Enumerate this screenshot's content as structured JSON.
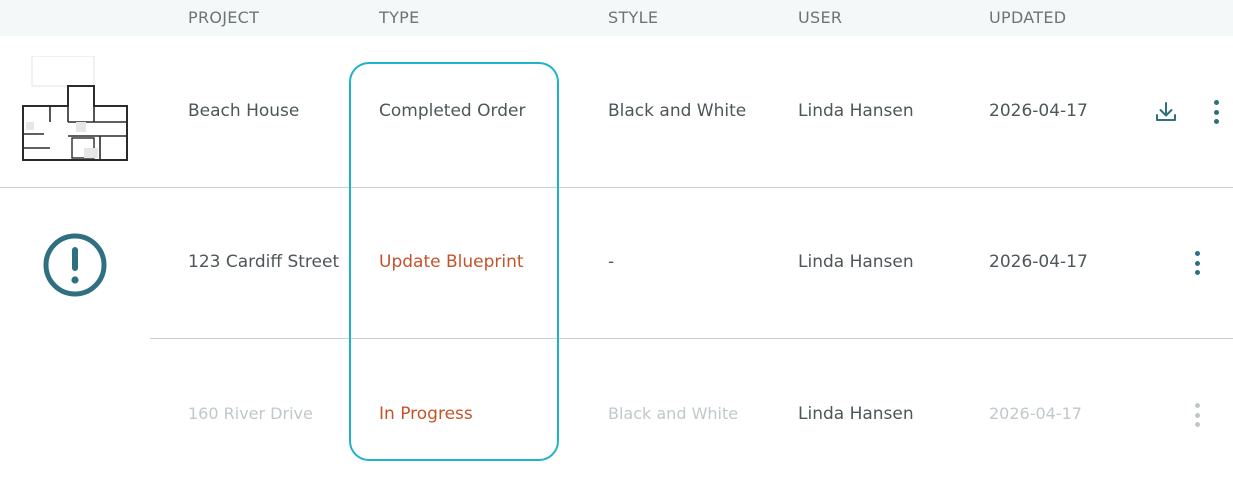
{
  "table": {
    "headers": {
      "project": "PROJECT",
      "type": "TYPE",
      "style": "STYLE",
      "user": "USER",
      "updated": "UPDATED"
    },
    "rows": [
      {
        "thumbnail": "floorplan-thumbnail",
        "project": "Beach House",
        "type": "Completed Order",
        "style": "Black and White",
        "user": "Linda Hansen",
        "updated": "2026-04-17",
        "actions": [
          "download-icon",
          "more-vertical-icon"
        ]
      },
      {
        "thumbnail": "alert-circle-icon",
        "project": "123 Cardiff Street",
        "type": "Update Blueprint",
        "style": "-",
        "user": "Linda Hansen",
        "updated": "2026-04-17",
        "actions": [
          "more-vertical-icon"
        ]
      },
      {
        "thumbnail": "",
        "project": "160 River Drive",
        "type": "In Progress",
        "style": "Black and White",
        "user": "Linda Hansen",
        "updated": "2026-04-17",
        "actions": [
          "more-vertical-icon"
        ]
      }
    ]
  },
  "colors": {
    "accent": "#2f7080",
    "highlight_border": "#1fb2c9",
    "warning_text": "#c4532a",
    "faded_text": "#c0c8cb",
    "header_bg": "#f5f8f9"
  }
}
